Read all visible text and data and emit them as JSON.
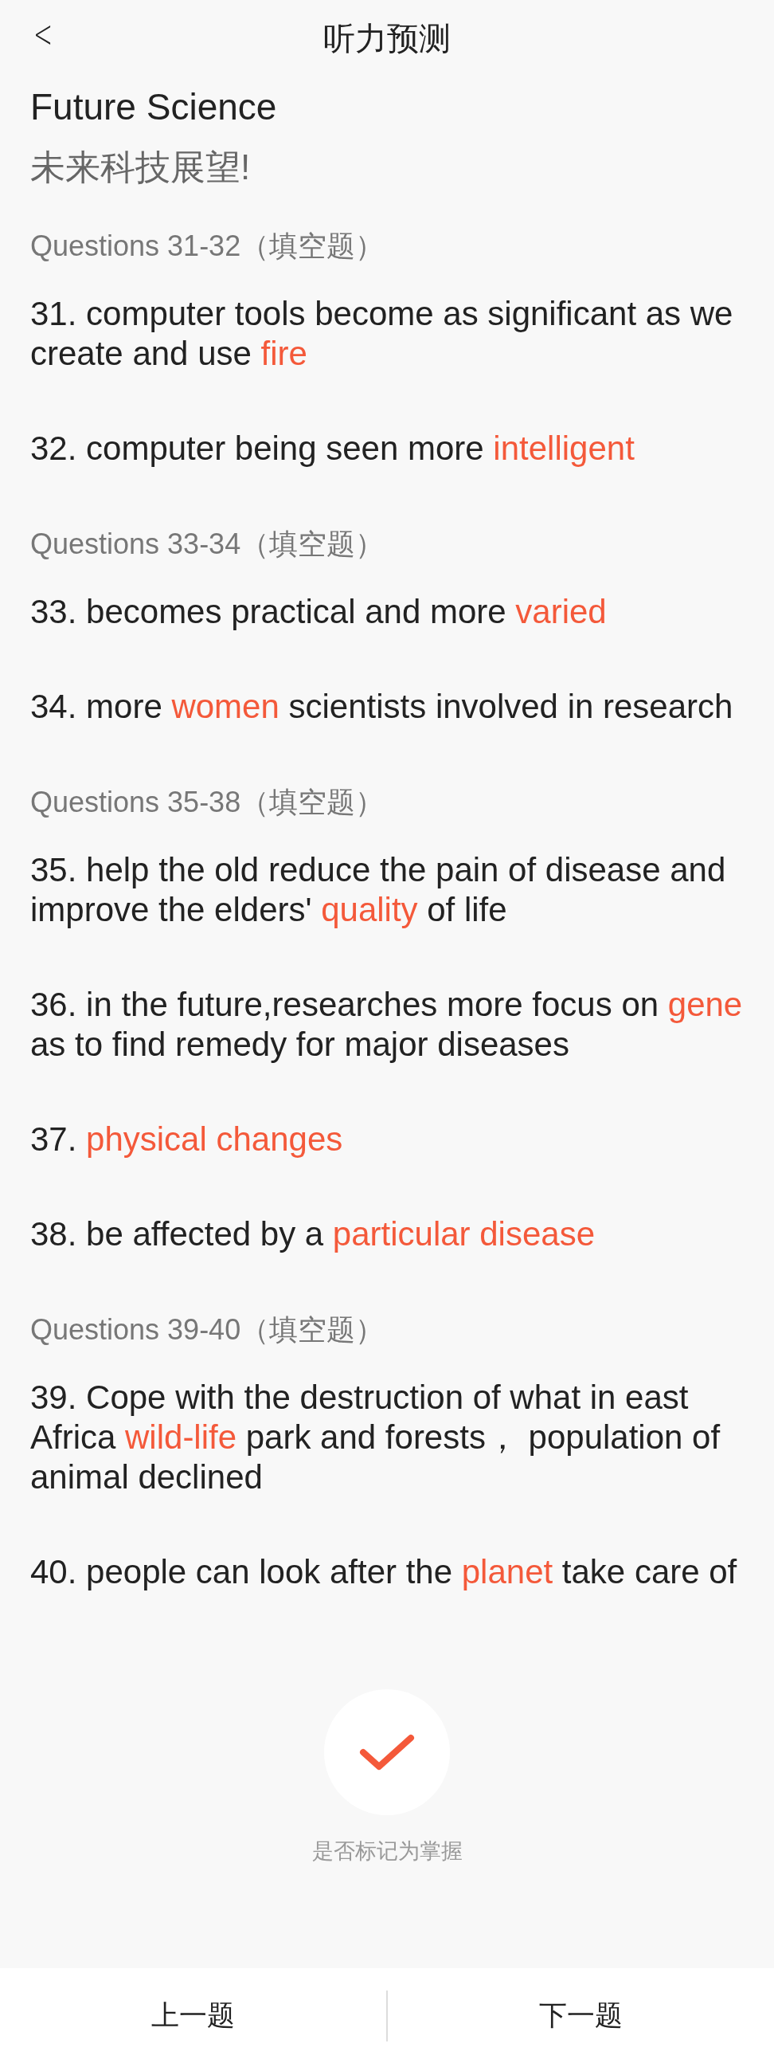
{
  "header": {
    "back": "<",
    "title": "听力预测"
  },
  "title": "Future Science",
  "subtitle": "未来科技展望!",
  "sections": [
    {
      "heading": "Questions 31-32（填空题）",
      "questions": [
        {
          "segments": [
            {
              "text": "31. computer tools become as significant as we create and use ",
              "highlight": false
            },
            {
              "text": "fire",
              "highlight": true
            }
          ]
        },
        {
          "segments": [
            {
              "text": "32. computer being seen more ",
              "highlight": false
            },
            {
              "text": "intelligent",
              "highlight": true
            }
          ]
        }
      ]
    },
    {
      "heading": "Questions 33-34（填空题）",
      "questions": [
        {
          "segments": [
            {
              "text": "33. becomes practical and more ",
              "highlight": false
            },
            {
              "text": "varied",
              "highlight": true
            }
          ]
        },
        {
          "segments": [
            {
              "text": "34. more ",
              "highlight": false
            },
            {
              "text": "women",
              "highlight": true
            },
            {
              "text": " scientists involved in research",
              "highlight": false
            }
          ]
        }
      ]
    },
    {
      "heading": "Questions 35-38（填空题）",
      "questions": [
        {
          "segments": [
            {
              "text": "35. help the old reduce the pain of disease and improve the elders' ",
              "highlight": false
            },
            {
              "text": "quality",
              "highlight": true
            },
            {
              "text": " of life",
              "highlight": false
            }
          ]
        },
        {
          "segments": [
            {
              "text": "36. in the future,researches more focus on ",
              "highlight": false
            },
            {
              "text": "gene",
              "highlight": true
            },
            {
              "text": " as to find remedy for major diseases",
              "highlight": false
            }
          ]
        },
        {
          "segments": [
            {
              "text": "37. ",
              "highlight": false
            },
            {
              "text": "physical changes",
              "highlight": true
            }
          ]
        },
        {
          "segments": [
            {
              "text": "38. be affected by a ",
              "highlight": false
            },
            {
              "text": "particular disease",
              "highlight": true
            }
          ]
        }
      ]
    },
    {
      "heading": "Questions 39-40（填空题）",
      "questions": [
        {
          "segments": [
            {
              "text": "39. Cope with the destruction of what in east Africa ",
              "highlight": false
            },
            {
              "text": "wild-life",
              "highlight": true
            },
            {
              "text": " park and forests， population of animal declined",
              "highlight": false
            }
          ]
        },
        {
          "segments": [
            {
              "text": "40. people can look after the ",
              "highlight": false
            },
            {
              "text": "planet",
              "highlight": true
            },
            {
              "text": " take care of",
              "highlight": false
            }
          ]
        }
      ]
    }
  ],
  "mark": {
    "label": "是否标记为掌握"
  },
  "footer": {
    "prev": "上一题",
    "next": "下一题"
  }
}
